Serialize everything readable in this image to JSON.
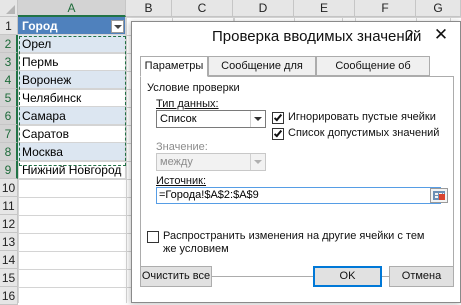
{
  "sheet": {
    "columns": [
      "A",
      "B",
      "C",
      "D",
      "E",
      "F",
      "G"
    ],
    "rows": [
      "1",
      "2",
      "3",
      "4",
      "5",
      "6",
      "7",
      "8",
      "9",
      "10",
      "11",
      "12",
      "13",
      "14",
      "15",
      "16"
    ],
    "header_cell": "Город",
    "cities": [
      "Орел",
      "Пермь",
      "Воронеж",
      "Челябинск",
      "Самара",
      "Саратов",
      "Москва",
      "Нижний Новгород"
    ],
    "accent_color": "#217346",
    "header_fill": "#4f81bd",
    "band_fill": "#dce6f1"
  },
  "dialog": {
    "title": "Проверка вводимых значений",
    "help": "?",
    "close": "✕",
    "tabs": [
      "Параметры",
      "Сообщение для ввода",
      "Сообщение об ошибке"
    ],
    "group_label": "Условие проверки",
    "data_type_label": "Тип данных:",
    "data_type_value": "Список",
    "ignore_blank_label": "Игнорировать пустые ячейки",
    "ignore_blank_checked": true,
    "dropdown_list_label": "Список допустимых значений",
    "dropdown_list_checked": true,
    "value_label": "Значение:",
    "value_value": "между",
    "source_label": "Источник:",
    "source_value": "=Города!$A$2:$A$9",
    "apply_all_label": "Распространить изменения на другие ячейки с тем же условием",
    "apply_all_checked": false,
    "clear_all": "Очистить все",
    "ok": "OK",
    "cancel": "Отмена"
  }
}
